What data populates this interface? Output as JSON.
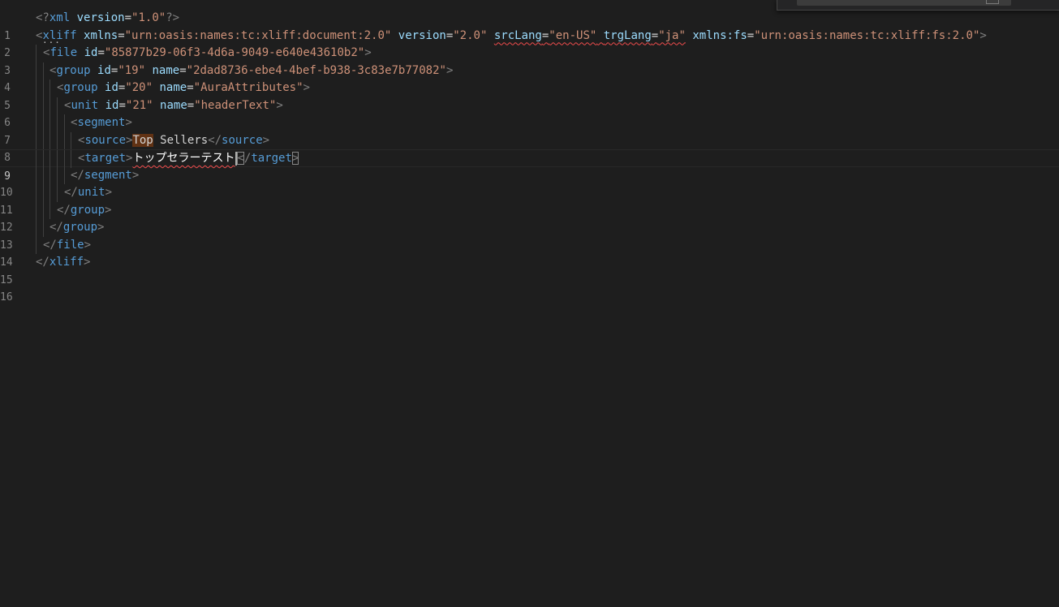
{
  "editor": {
    "language": "xml",
    "active_line": 9,
    "lines": [
      {
        "n": "1"
      },
      {
        "n": "2"
      },
      {
        "n": "3"
      },
      {
        "n": "4"
      },
      {
        "n": "5"
      },
      {
        "n": "6"
      },
      {
        "n": "7"
      },
      {
        "n": "8"
      },
      {
        "n": "9"
      },
      {
        "n": "10"
      },
      {
        "n": "11"
      },
      {
        "n": "12"
      },
      {
        "n": "13"
      },
      {
        "n": "14"
      },
      {
        "n": "15"
      },
      {
        "n": "16"
      }
    ],
    "code": {
      "decl": {
        "open": "<?",
        "name": "xml",
        "attr": "version",
        "eq": "=",
        "val": "\"1.0\"",
        "close": "?>"
      },
      "xliff": {
        "tag": "xliff",
        "xmlns_attr": "xmlns",
        "xmlns_val": "\"urn:oasis:names:tc:xliff:document:2.0\"",
        "version_attr": "version",
        "version_val": "\"2.0\"",
        "srclang_attr": "srcLang",
        "srclang_val": "\"en-US\"",
        "trglang_attr": "trgLang",
        "trglang_val": "\"ja\"",
        "xmlnsfs_attr": "xmlns:fs",
        "xmlnsfs_val": "\"urn:oasis:names:tc:xliff:fs:2.0\""
      },
      "file": {
        "tag": "file",
        "id_attr": "id",
        "id_val": "\"85877b29-06f3-4d6a-9049-e640e43610b2\""
      },
      "group1": {
        "tag": "group",
        "id_attr": "id",
        "id_val": "\"19\"",
        "name_attr": "name",
        "name_val": "\"2dad8736-ebe4-4bef-b938-3c83e7b77082\""
      },
      "group2": {
        "tag": "group",
        "id_attr": "id",
        "id_val": "\"20\"",
        "name_attr": "name",
        "name_val": "\"AuraAttributes\""
      },
      "unit": {
        "tag": "unit",
        "id_attr": "id",
        "id_val": "\"21\"",
        "name_attr": "name",
        "name_val": "\"headerText\""
      },
      "segment": {
        "tag": "segment"
      },
      "source": {
        "tag": "source",
        "text_a": "Top",
        "text_b": " Sellers"
      },
      "target": {
        "tag": "target",
        "text": "トップセラーテスト"
      }
    }
  },
  "colors": {
    "background": "#1e1e1e",
    "tag": "#569cd6",
    "attribute": "#9cdcfe",
    "string": "#ce9178",
    "punctuation": "#808080",
    "error_squiggle": "#f14c4c"
  }
}
